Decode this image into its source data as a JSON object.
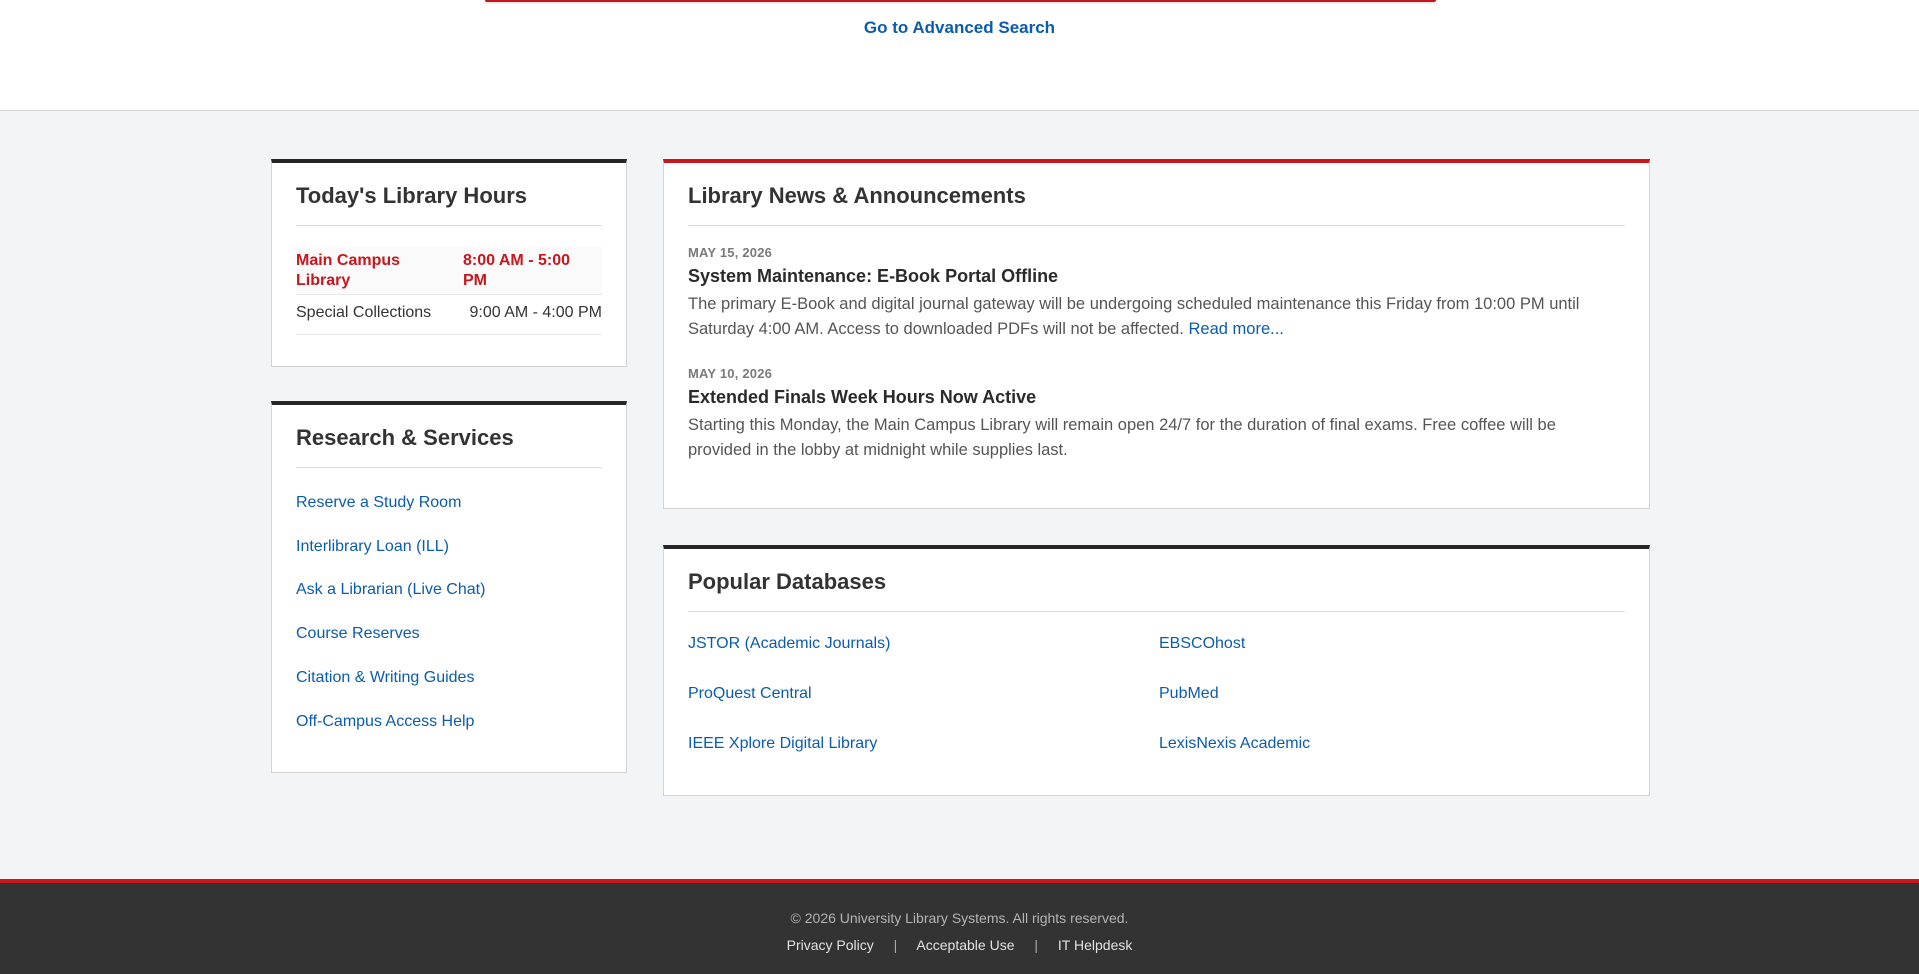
{
  "search": {
    "advanced_link": "Go to Advanced Search"
  },
  "hours": {
    "title": "Today's Library Hours",
    "rows": [
      {
        "location": "Main Campus Library",
        "time": "8:00 AM - 5:00 PM",
        "status": "open"
      },
      {
        "location": "Special Collections",
        "time": "9:00 AM - 4:00 PM",
        "status": "regular"
      }
    ]
  },
  "services": {
    "title": "Research & Services",
    "links": [
      "Reserve a Study Room",
      "Interlibrary Loan (ILL)",
      "Ask a Librarian (Live Chat)",
      "Course Reserves",
      "Citation & Writing Guides",
      "Off-Campus Access Help"
    ]
  },
  "news": {
    "title": "Library News & Announcements",
    "items": [
      {
        "date": "MAY 15, 2026",
        "headline": "System Maintenance: E-Book Portal Offline",
        "body": "The primary E-Book and digital journal gateway will be undergoing scheduled maintenance this Friday from 10:00 PM until Saturday 4:00 AM. Access to downloaded PDFs will not be affected.",
        "more_link": "Read more..."
      },
      {
        "date": "MAY 10, 2026",
        "headline": "Extended Finals Week Hours Now Active",
        "body": "Starting this Monday, the Main Campus Library will remain open 24/7 for the duration of final exams. Free coffee will be provided in the lobby at midnight while supplies last."
      }
    ]
  },
  "databases": {
    "title": "Popular Databases",
    "links": [
      "JSTOR (Academic Journals)",
      "EBSCOhost",
      "ProQuest Central",
      "PubMed",
      "IEEE Xplore Digital Library",
      "LexisNexis Academic"
    ]
  },
  "footer": {
    "copyright": "© 2026 University Library Systems. All rights reserved.",
    "links": [
      "Privacy Policy",
      "Acceptable Use",
      "IT Helpdesk"
    ],
    "separator": "|"
  },
  "colors": {
    "accent_red": "#c8161d",
    "link_blue": "#0b5cad",
    "footer_bg": "#333333",
    "page_bg": "#f3f4f5"
  }
}
